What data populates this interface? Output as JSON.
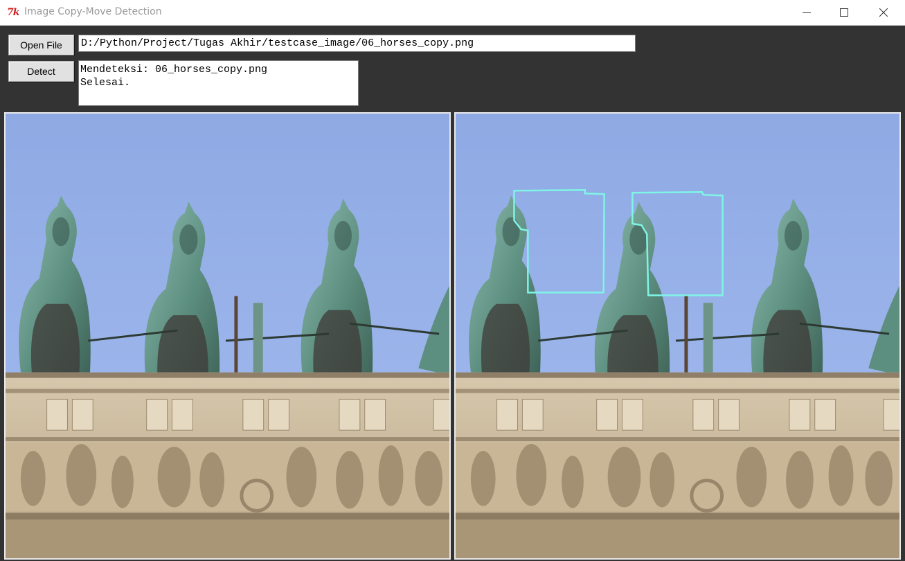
{
  "window": {
    "title": "Image Copy-Move Detection",
    "app_icon": "tk-icon",
    "controls": [
      "minimize-icon",
      "maximize-icon",
      "close-icon"
    ]
  },
  "toolbar": {
    "open_label": "Open File",
    "detect_label": "Detect",
    "file_path": "D:/Python/Project/Tugas Akhir/testcase_image/06_horses_copy.png"
  },
  "log": {
    "lines": [
      "Mendeteksi: 06_horses_copy.png",
      "Selesai."
    ]
  },
  "images": {
    "original_subject": "horse-statues-photo",
    "result_subject": "horse-statues-photo-with-detection",
    "detection_color": "#7ff5e6",
    "detected_regions": 2
  },
  "colors": {
    "window_bg": "#333333",
    "sky": "#9bb3e6",
    "bronze": "#5f8f80",
    "stone": "#cdbb9e"
  }
}
